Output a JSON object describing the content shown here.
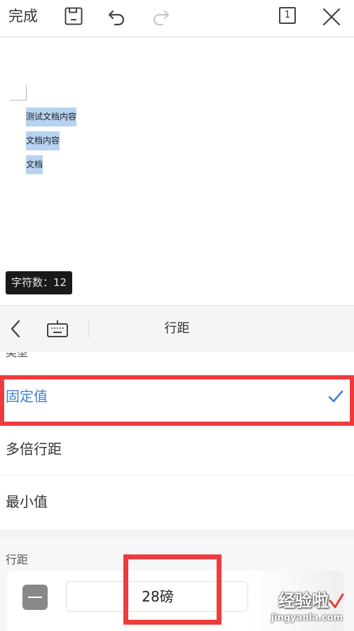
{
  "toolbar": {
    "done_label": "完成",
    "page_count": "1",
    "icons": [
      "save-icon",
      "undo-icon",
      "redo-icon",
      "page-count-icon",
      "close-icon"
    ]
  },
  "document": {
    "lines": [
      "测试文档内容",
      "文档内容",
      "文档"
    ],
    "selection_color": "#b7d3f2"
  },
  "char_count": {
    "label": "字符数：",
    "value": "12"
  },
  "panel": {
    "title": "行距",
    "icons": [
      "chevron-left-icon",
      "keyboard-icon"
    ]
  },
  "type_section": {
    "label": "类型",
    "options": [
      {
        "label": "固定值",
        "selected": true
      },
      {
        "label": "多倍行距",
        "selected": false
      },
      {
        "label": "最小值",
        "selected": false
      }
    ],
    "accent_color": "#3e7fd8"
  },
  "spacing": {
    "label": "行距",
    "value": "28磅"
  },
  "annotation_color": "#ef3b3b",
  "watermark": {
    "text": "经验啦",
    "subtext": "jingyanla.com"
  }
}
